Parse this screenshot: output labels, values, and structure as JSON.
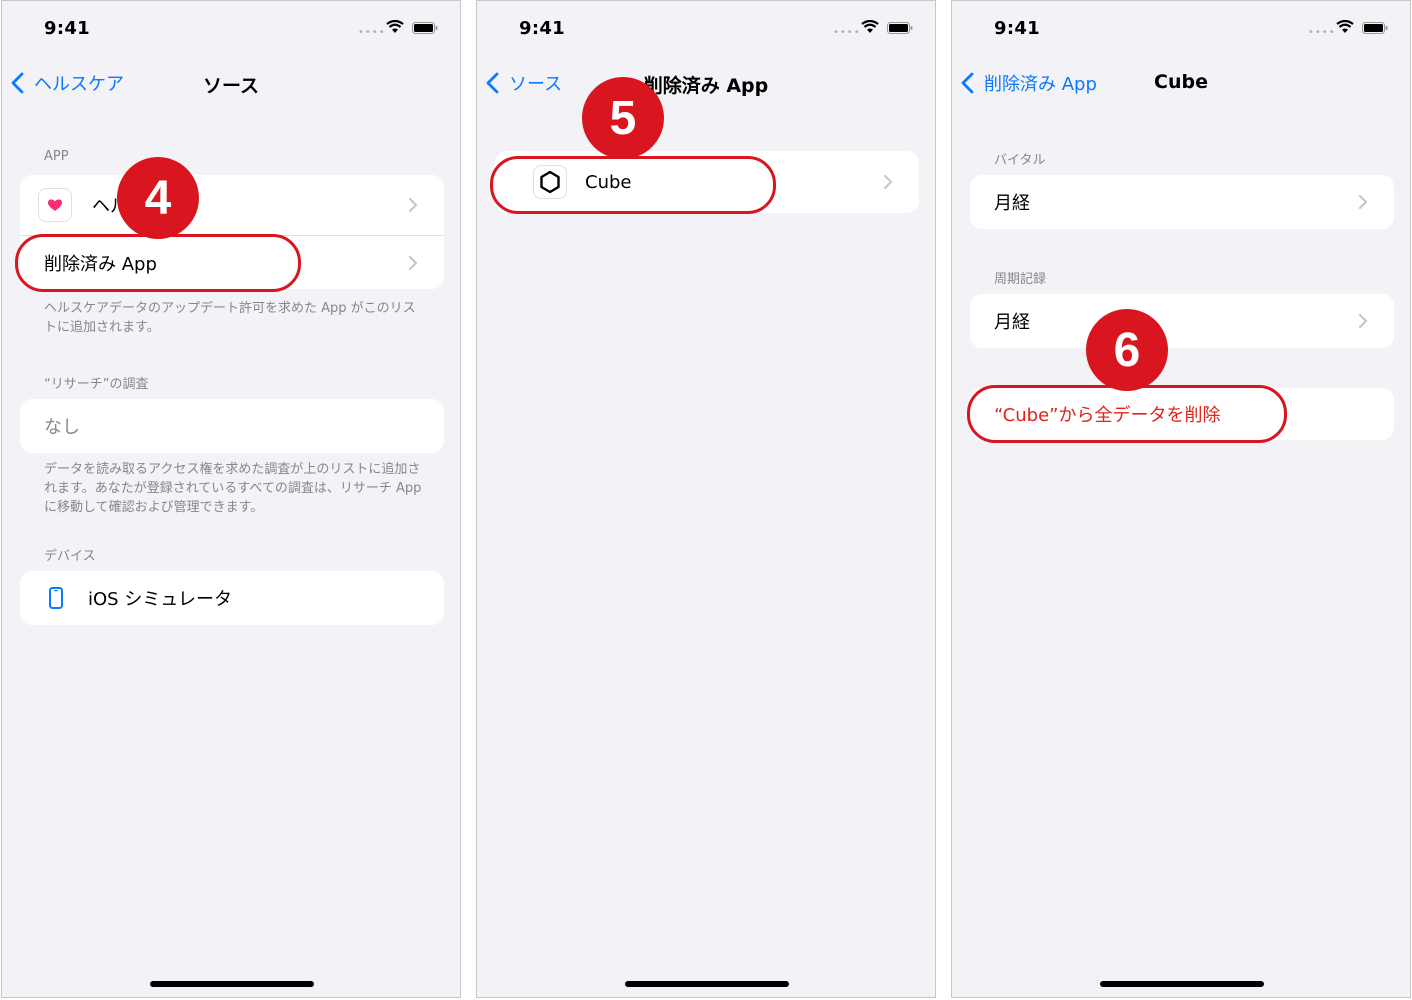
{
  "status": {
    "time": "9:41"
  },
  "screen1": {
    "back_label": "ヘルスケア",
    "title": "ソース",
    "app_header": "APP",
    "health_row_label": "ヘル",
    "deleted_apps_label": "削除済み App",
    "app_footer": "ヘルスケアデータのアップデート許可を求めた App がこのリストに追加されます。",
    "research_header": "“リサーチ”の調査",
    "research_none": "なし",
    "research_footer": "データを読み取るアクセス権を求めた調査が上のリストに追加されます。あなたが登録されているすべての調査は、リサーチ App に移動して確認および管理できます。",
    "devices_header": "デバイス",
    "device_label": "iOS シミュレータ",
    "step_badge": "4"
  },
  "screen2": {
    "back_label": "ソース",
    "title": "削除済み App",
    "app_label": "Cube",
    "step_badge": "5"
  },
  "screen3": {
    "back_label": "削除済み App",
    "title": "Cube",
    "vitals_header": "バイタル",
    "vitals_row": "月経",
    "cycle_header": "周期記録",
    "cycle_row": "月経",
    "delete_label": "“Cube”から全データを削除",
    "step_badge": "6"
  },
  "colors": {
    "accent": "#0a7aff",
    "callout": "#d9161f",
    "destructive": "#e2231a"
  }
}
